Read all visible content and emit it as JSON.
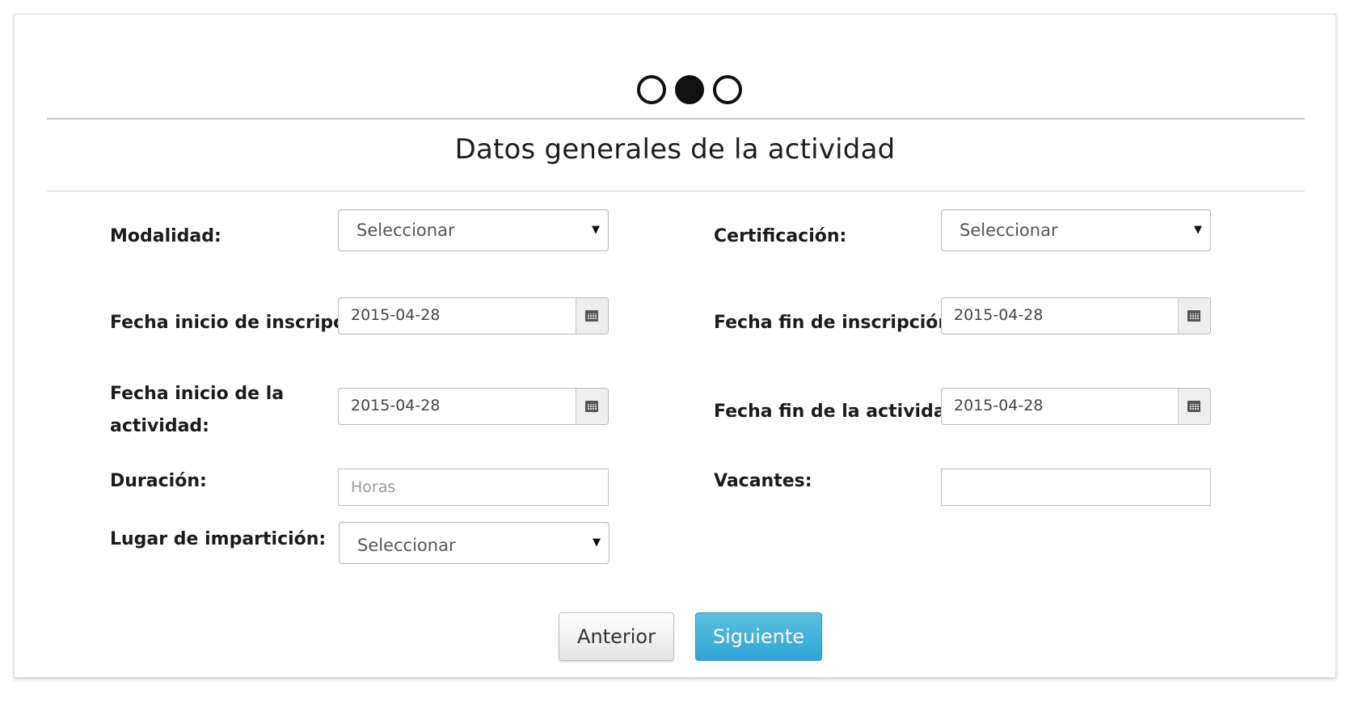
{
  "stepper": {
    "steps": [
      {
        "state": "inactive"
      },
      {
        "state": "active"
      },
      {
        "state": "inactive"
      }
    ]
  },
  "form": {
    "title": "Datos generales de la actividad",
    "modalidad": {
      "label": "Modalidad:",
      "value": "Seleccionar"
    },
    "certificacion": {
      "label": "Certificación:",
      "value": "Seleccionar"
    },
    "fecha_inicio_inscripcion": {
      "label": "Fecha inicio de inscripción:",
      "value": "2015-04-28"
    },
    "fecha_fin_inscripcion": {
      "label": "Fecha fin de inscripción:",
      "value": "2015-04-28"
    },
    "fecha_inicio_actividad": {
      "label_line1": "Fecha inicio de la",
      "label_line2": "actividad:",
      "value": "2015-04-28"
    },
    "fecha_fin_actividad": {
      "label": "Fecha fin de la actividad:",
      "value": "2015-04-28"
    },
    "duracion": {
      "label": "Duración:",
      "placeholder": "Horas",
      "value": ""
    },
    "vacantes": {
      "label": "Vacantes:",
      "value": ""
    },
    "lugar": {
      "label": "Lugar de impartición:",
      "value": "Seleccionar"
    }
  },
  "buttons": {
    "prev_label": "Anterior",
    "next_label": "Siguiente"
  },
  "icons": {
    "caret": "caret-down-icon",
    "calendar": "calendar-icon"
  },
  "colors": {
    "primary_button": "#31b0d5",
    "step_active": "#111111"
  }
}
